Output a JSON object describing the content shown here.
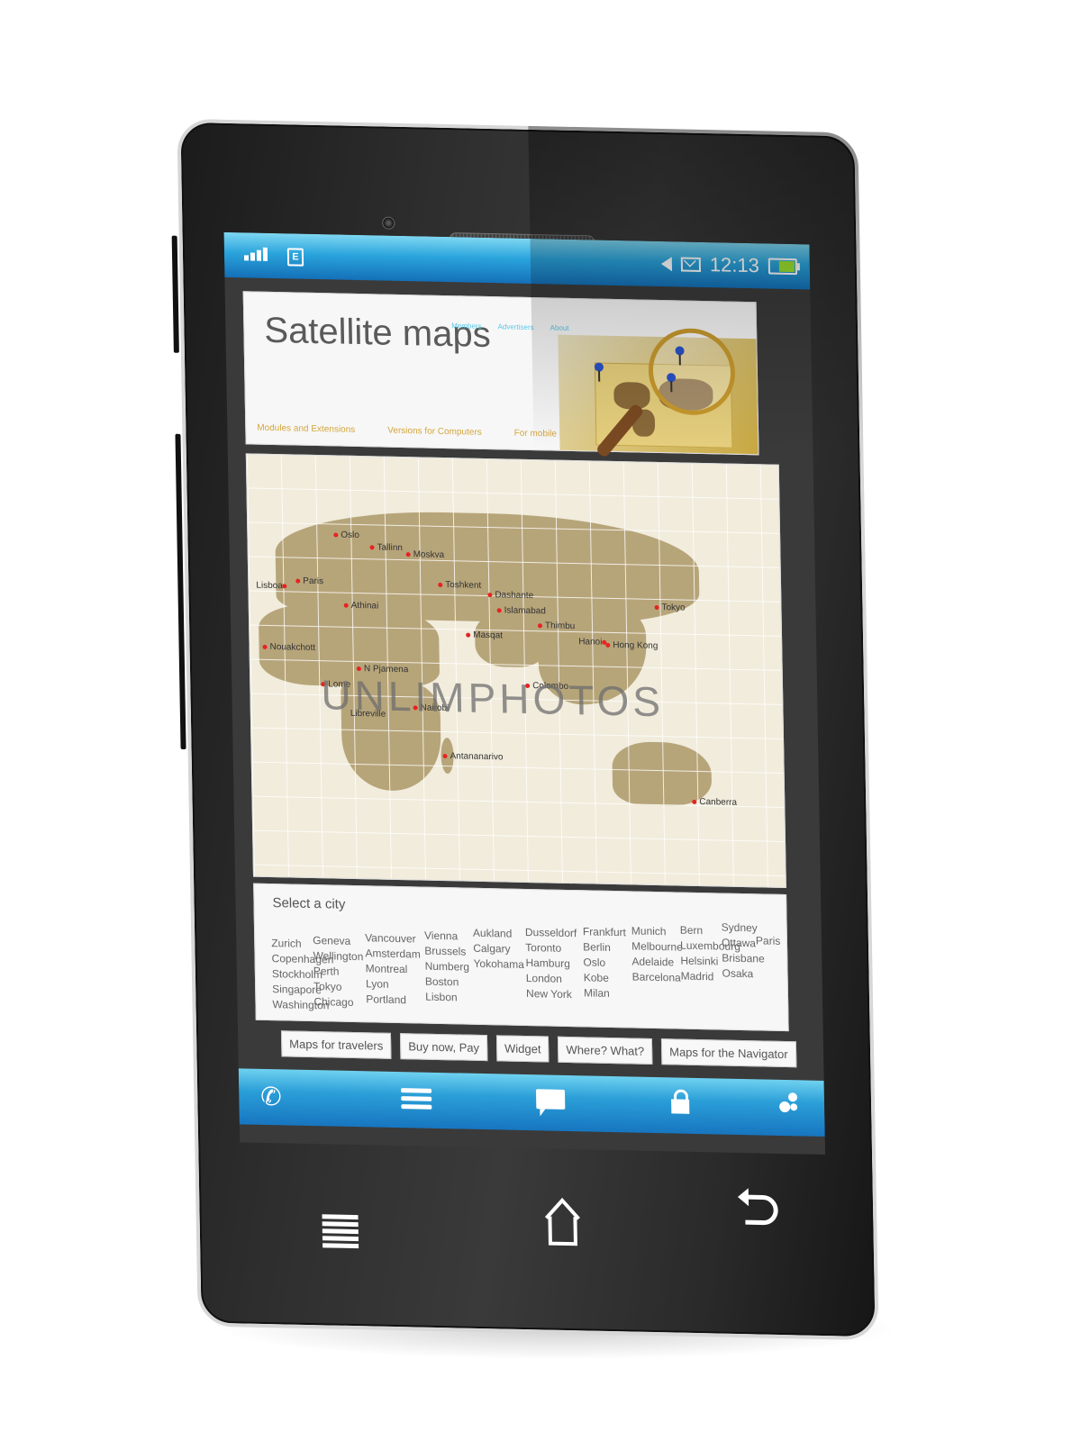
{
  "status_bar": {
    "network_type": "E",
    "signal_icon": "signal-bars-icon",
    "notification_icon": "triangle-icon",
    "mail_icon": "mail-icon",
    "time": "12:13",
    "battery_icon": "battery-icon",
    "battery_level": 0.6
  },
  "site": {
    "title": "Satellite maps",
    "top_links": [
      "Members",
      "Advertisers",
      "About"
    ],
    "sub_links": [
      "Modules and Extensions",
      "Versions for Computers",
      "For mobile phones"
    ],
    "accent_link_color": "#55c8ea",
    "sub_link_color": "#d4a63d"
  },
  "map": {
    "cities": [
      "Oslo",
      "Tallinn",
      "Moskva",
      "Lisboa",
      "Paris",
      "Athinai",
      "Toshkent",
      "Dashante",
      "Islamabad",
      "Thimbu",
      "Tokyo",
      "Masqat",
      "Hanoi",
      "Hong Kong",
      "Nouakchott",
      "N Pjamena",
      "Lome",
      "Colombo",
      "Libreville",
      "Nairobi",
      "Antananarivo",
      "Canberra"
    ],
    "marker_color": "#e82222",
    "watermark": "UNLIMPHOTOS"
  },
  "city_select": {
    "title": "Select a city",
    "cities": [
      "Zurich",
      "Geneva",
      "Vancouver",
      "Vienna",
      "Aukland",
      "Dusseldorf",
      "Frankfurt",
      "Munich",
      "Bern",
      "Sydney",
      "Copenhagen",
      "Wellington",
      "Amsterdam",
      "Brussels",
      "Toronto",
      "Berlin",
      "Melbourne",
      "Luxembourg",
      "Ottawa",
      "Stockholm",
      "Perth",
      "Montreal",
      "Numberg",
      "Calgary",
      "Hamburg",
      "Oslo",
      "Adelaide",
      "Helsinki",
      "Brisbane",
      "Paris",
      "Singapore",
      "Tokyo",
      "Lyon",
      "Boston",
      "Yokohama",
      "London",
      "Kobe",
      "Barcelona",
      "Madrid",
      "Osaka",
      "Washington",
      "Chicago",
      "Portland",
      "Lisbon",
      "New York",
      "Milan"
    ]
  },
  "buttons": [
    "Maps for travelers",
    "Buy now, Pay",
    "Widget",
    "Where? What?",
    "Maps for the Navigator"
  ],
  "nav_bar": {
    "items": [
      "phone-icon",
      "menu-icon",
      "chat-icon",
      "unlock-icon",
      "bubbles-icon"
    ]
  },
  "hardware_buttons": [
    "menu-icon",
    "home-icon",
    "back-icon"
  ],
  "colors": {
    "status_bar_blue": "#2aa4dc",
    "map_land": "#b7a57a",
    "map_ocean": "#f1ecdc"
  }
}
